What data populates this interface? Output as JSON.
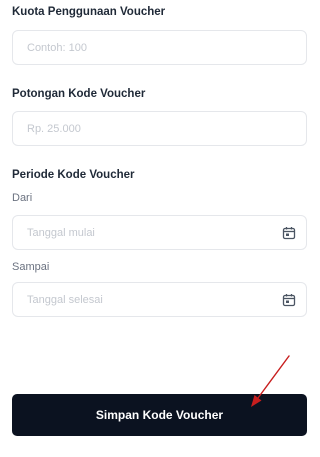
{
  "kuota": {
    "label": "Kuota Penggunaan Voucher",
    "placeholder": "Contoh: 100",
    "value": ""
  },
  "potongan": {
    "label": "Potongan Kode Voucher",
    "placeholder": "Rp. 25.000",
    "value": ""
  },
  "periode": {
    "label": "Periode Kode Voucher",
    "dari": {
      "label": "Dari",
      "placeholder": "Tanggal mulai",
      "value": "",
      "icon": "calendar-icon"
    },
    "sampai": {
      "label": "Sampai",
      "placeholder": "Tanggal selesai",
      "value": "",
      "icon": "calendar-icon"
    }
  },
  "submit": {
    "label": "Simpan Kode Voucher"
  },
  "colors": {
    "button_bg": "#0b1220",
    "arrow": "#c81e1e",
    "placeholder": "#c4c8cf"
  }
}
